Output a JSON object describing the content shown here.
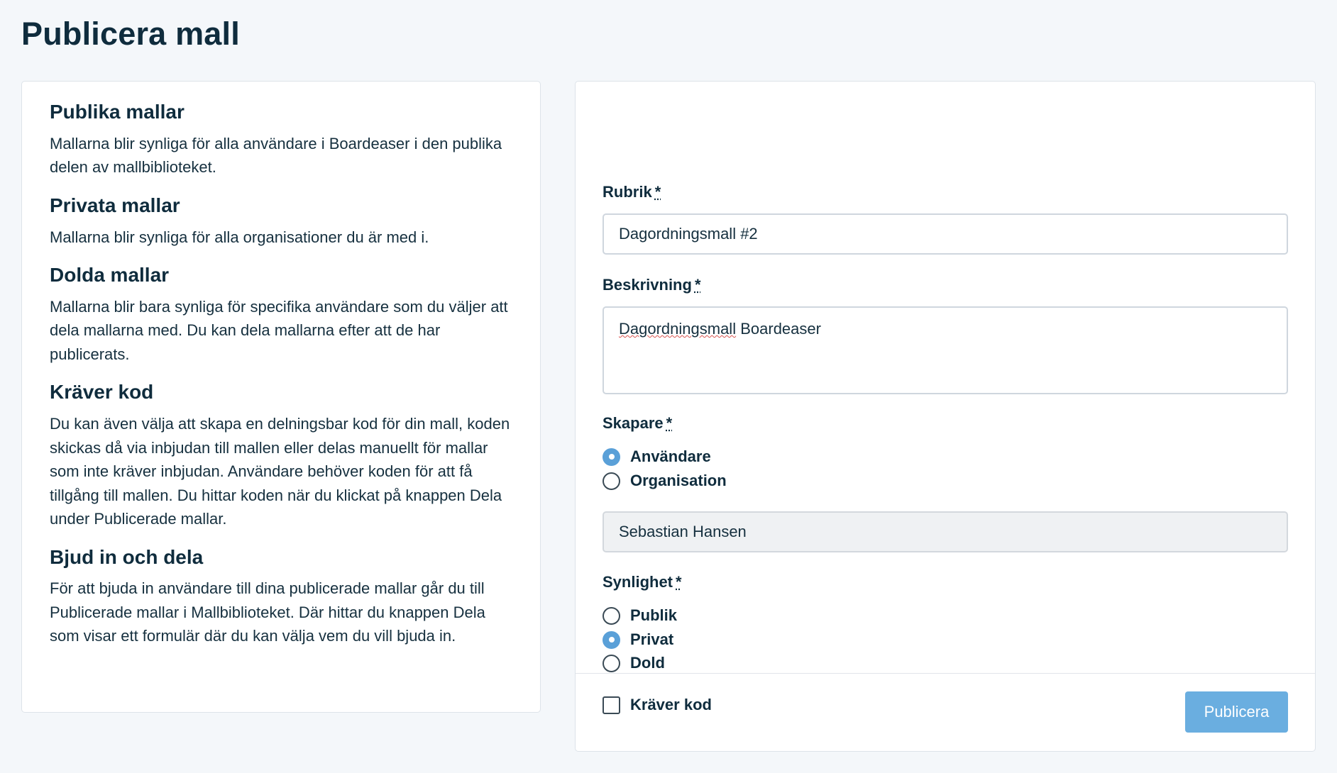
{
  "page": {
    "title": "Publicera mall"
  },
  "info": {
    "sections": [
      {
        "heading": "Publika mallar",
        "text": "Mallarna blir synliga för alla användare i Boardeaser i den publika delen av mallbiblioteket."
      },
      {
        "heading": "Privata mallar",
        "text": "Mallarna blir synliga för alla organisationer du är med i."
      },
      {
        "heading": "Dolda mallar",
        "text": "Mallarna blir bara synliga för specifika användare som du väljer att dela mallarna med. Du kan dela mallarna efter att de har publicerats."
      },
      {
        "heading": "Kräver kod",
        "text": "Du kan även välja att skapa en delningsbar kod för din mall, koden skickas då via inbjudan till mallen eller delas manuellt för mallar som inte kräver inbjudan. Användare behöver koden för att få tillgång till mallen. Du hittar koden när du klickat på knappen Dela under Publicerade mallar."
      },
      {
        "heading": "Bjud in och dela",
        "text": "För att bjuda in användare till dina publicerade mallar går du till Publicerade mallar i Mallbiblioteket. Där hittar du knappen Dela som visar ett formulär där du kan välja vem du vill bjuda in."
      }
    ]
  },
  "form": {
    "rubrik": {
      "label": "Rubrik",
      "required_mark": "*",
      "value": "Dagordningsmall #2"
    },
    "beskrivning": {
      "label": "Beskrivning",
      "required_mark": "*",
      "value_word1": "Dagordningsmall",
      "value_word2": "Boardeaser"
    },
    "skapare": {
      "label": "Skapare",
      "required_mark": "*",
      "options": [
        {
          "label": "Användare",
          "checked": true
        },
        {
          "label": "Organisation",
          "checked": false
        }
      ],
      "selected_value": "Sebastian Hansen"
    },
    "synlighet": {
      "label": "Synlighet",
      "required_mark": "*",
      "options": [
        {
          "label": "Publik",
          "checked": false
        },
        {
          "label": "Privat",
          "checked": true
        },
        {
          "label": "Dold",
          "checked": false
        }
      ]
    },
    "kraver_kod": {
      "label": "Kräver kod",
      "checked": false
    },
    "submit_label": "Publicera"
  },
  "colors": {
    "accent": "#5aa0d8",
    "button": "#6aaee0",
    "background": "#f4f7fa",
    "text": "#0f2c3d"
  }
}
